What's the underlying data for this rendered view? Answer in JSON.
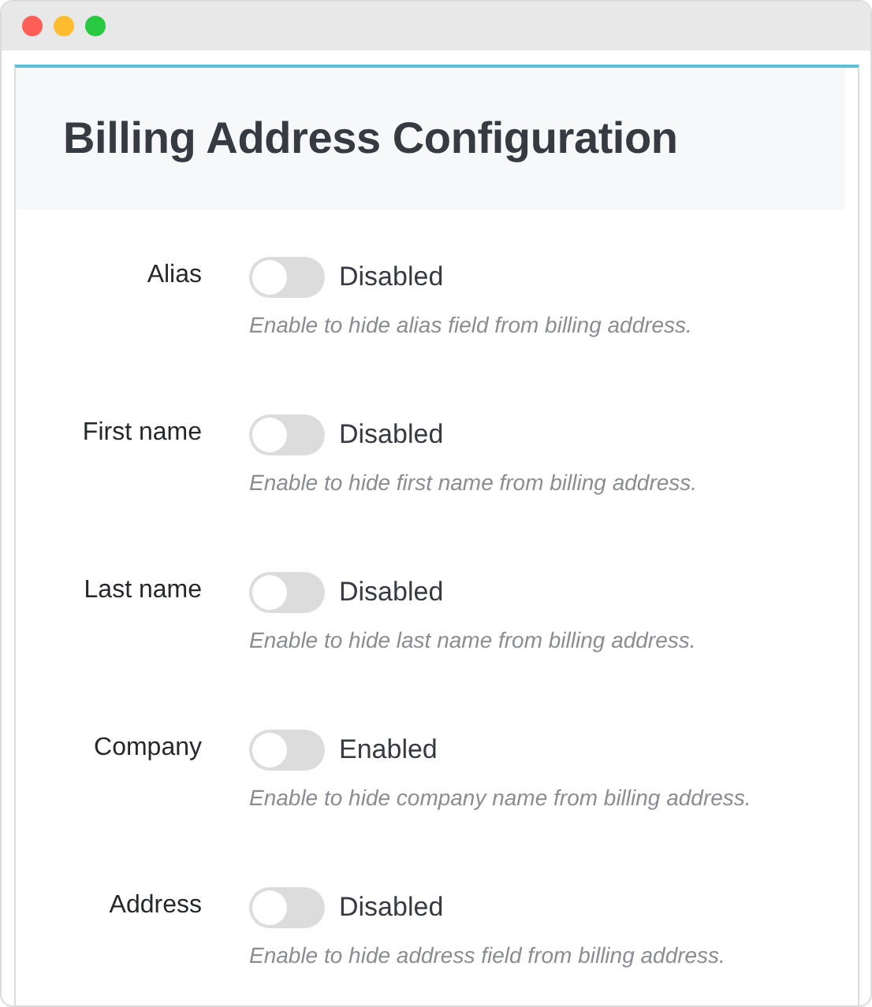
{
  "panel": {
    "title": "Billing Address Configuration"
  },
  "settings": [
    {
      "label": "Alias",
      "on": false,
      "status": "Disabled",
      "description": "Enable to hide alias field from billing address."
    },
    {
      "label": "First name",
      "on": false,
      "status": "Disabled",
      "description": "Enable to hide first name from billing address."
    },
    {
      "label": "Last name",
      "on": false,
      "status": "Disabled",
      "description": "Enable to hide last name from billing address."
    },
    {
      "label": "Company",
      "on": false,
      "status": "Enabled",
      "description": "Enable to hide company name from billing address."
    },
    {
      "label": "Address",
      "on": false,
      "status": "Disabled",
      "description": "Enable to hide address field from billing address."
    }
  ]
}
